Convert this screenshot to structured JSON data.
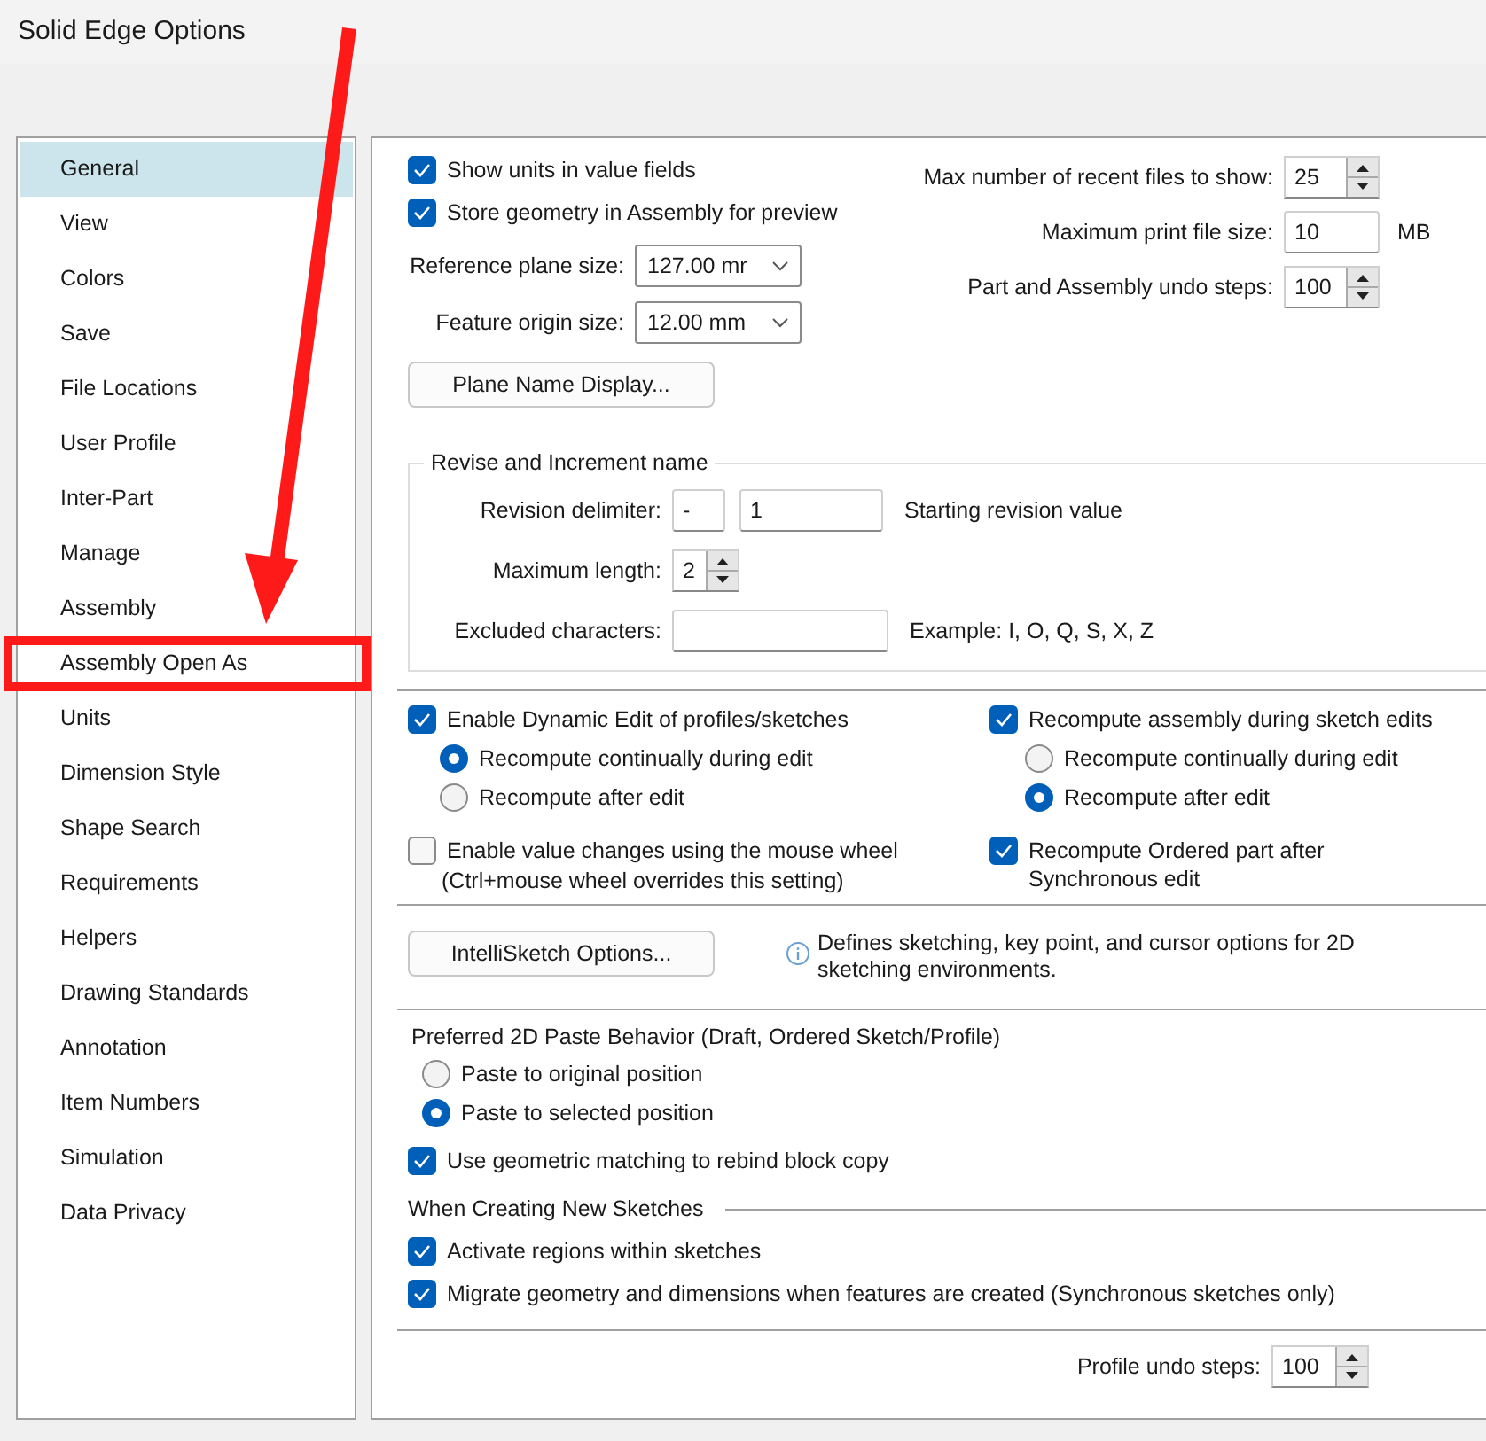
{
  "window": {
    "title": "Solid Edge Options"
  },
  "sidebar": {
    "items": [
      {
        "label": "General",
        "selected": true,
        "highlighted": false
      },
      {
        "label": "View",
        "selected": false,
        "highlighted": false
      },
      {
        "label": "Colors",
        "selected": false,
        "highlighted": false
      },
      {
        "label": "Save",
        "selected": false,
        "highlighted": false
      },
      {
        "label": "File Locations",
        "selected": false,
        "highlighted": false
      },
      {
        "label": "User Profile",
        "selected": false,
        "highlighted": false
      },
      {
        "label": "Inter-Part",
        "selected": false,
        "highlighted": false
      },
      {
        "label": "Manage",
        "selected": false,
        "highlighted": false
      },
      {
        "label": "Assembly",
        "selected": false,
        "highlighted": false
      },
      {
        "label": "Assembly Open As",
        "selected": false,
        "highlighted": true
      },
      {
        "label": "Units",
        "selected": false,
        "highlighted": false
      },
      {
        "label": "Dimension Style",
        "selected": false,
        "highlighted": false
      },
      {
        "label": "Shape Search",
        "selected": false,
        "highlighted": false
      },
      {
        "label": "Requirements",
        "selected": false,
        "highlighted": false
      },
      {
        "label": "Helpers",
        "selected": false,
        "highlighted": false
      },
      {
        "label": "Drawing Standards",
        "selected": false,
        "highlighted": false
      },
      {
        "label": "Annotation",
        "selected": false,
        "highlighted": false
      },
      {
        "label": "Item Numbers",
        "selected": false,
        "highlighted": false
      },
      {
        "label": "Simulation",
        "selected": false,
        "highlighted": false
      },
      {
        "label": "Data Privacy",
        "selected": false,
        "highlighted": false
      }
    ]
  },
  "top_left": {
    "checkboxes": [
      {
        "label": "Show units in value fields",
        "checked": true
      },
      {
        "label": "Store geometry in Assembly for preview",
        "checked": true
      }
    ],
    "combos": [
      {
        "label": "Reference plane size:",
        "value": "127.00 mr"
      },
      {
        "label": "Feature origin size:",
        "value": "12.00 mm"
      }
    ],
    "button": "Plane Name Display..."
  },
  "top_right": [
    {
      "kind": "spinner",
      "label": "Max number of recent files to show:",
      "value": "25"
    },
    {
      "kind": "field",
      "label": "Maximum print file size:",
      "value": "10",
      "unit": "MB"
    },
    {
      "kind": "spinner",
      "label": "Part and Assembly undo steps:",
      "value": "100"
    }
  ],
  "revise": {
    "title": "Revise and Increment name",
    "delimiter_label": "Revision delimiter:",
    "delimiter": "-",
    "start_value": "1",
    "start_label": "Starting revision value",
    "max_length_label": "Maximum length:",
    "max_length": "2",
    "excluded_label": "Excluded characters:",
    "example": "Example: I, O, Q, S, X, Z"
  },
  "dynamic": {
    "left": {
      "label": "Enable Dynamic Edit of profiles/sketches",
      "checked": true,
      "options": [
        {
          "label": "Recompute continually during edit",
          "selected": true
        },
        {
          "label": "Recompute after edit",
          "selected": false
        }
      ]
    },
    "right": {
      "label": "Recompute assembly during sketch edits",
      "checked": true,
      "options": [
        {
          "label": "Recompute continually during edit",
          "selected": false
        },
        {
          "label": "Recompute after edit",
          "selected": true
        }
      ]
    },
    "wheel": {
      "label": "Enable value changes using the mouse wheel",
      "note": "(Ctrl+mouse wheel overrides this setting)",
      "checked": false
    },
    "ordered": {
      "label": "Recompute Ordered part after Synchronous edit",
      "checked": true
    }
  },
  "intellisketch": {
    "button": "IntelliSketch Options...",
    "info": "Defines sketching, key point, and cursor options for 2D sketching environments."
  },
  "paste": {
    "title": "Preferred 2D Paste Behavior (Draft, Ordered Sketch/Profile)",
    "options": [
      {
        "label": "Paste to original position",
        "selected": false
      },
      {
        "label": "Paste to selected position",
        "selected": true
      }
    ],
    "rebind": {
      "label": "Use geometric matching to rebind block copy",
      "checked": true
    }
  },
  "sketches": {
    "title": "When Creating New Sketches",
    "checkboxes": [
      {
        "label": "Activate regions within sketches",
        "checked": true
      },
      {
        "label": "Migrate geometry and dimensions when features are created (Synchronous sketches only)",
        "checked": true
      }
    ]
  },
  "profile_undo": {
    "label": "Profile undo steps:",
    "value": "100"
  }
}
